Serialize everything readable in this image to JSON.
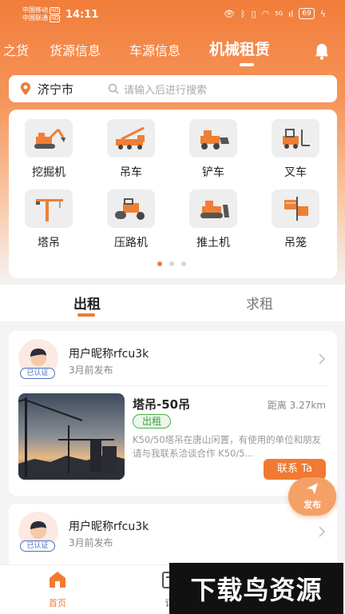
{
  "status_bar": {
    "carrier1": "中国移动",
    "carrier2": "中国联通",
    "hd": "HD",
    "time": "14:11",
    "signal_label": "5G",
    "battery": "69"
  },
  "top_tabs": [
    {
      "label": "之货"
    },
    {
      "label": "货源信息"
    },
    {
      "label": "车源信息"
    },
    {
      "label": "机械租赁",
      "active": true
    }
  ],
  "search": {
    "city": "济宁市",
    "placeholder": "请输入后进行搜索"
  },
  "categories": [
    {
      "label": "挖掘机",
      "icon": "excavator-icon"
    },
    {
      "label": "吊车",
      "icon": "crane-truck-icon"
    },
    {
      "label": "铲车",
      "icon": "loader-icon"
    },
    {
      "label": "叉车",
      "icon": "forklift-icon"
    },
    {
      "label": "塔吊",
      "icon": "tower-crane-icon"
    },
    {
      "label": "压路机",
      "icon": "road-roller-icon"
    },
    {
      "label": "推土机",
      "icon": "bulldozer-icon"
    },
    {
      "label": "吊笼",
      "icon": "hoist-cage-icon"
    }
  ],
  "pager": {
    "pages": 3,
    "current": 1
  },
  "sub_tabs": {
    "rent_out": "出租",
    "seek_rent": "求租"
  },
  "posts": [
    {
      "nickname": "用户昵称rfcu3k",
      "time": "3月前发布",
      "verified": "已认证",
      "title": "塔吊-50吊",
      "distance": "距离 3.27km",
      "tag": "出租",
      "desc": "K50/50塔吊在唐山闲置，有使用的单位和朋友请与我联系洽谈合作 K50/5...",
      "contact": "联系 Ta"
    },
    {
      "nickname": "用户昵称rfcu3k",
      "time": "3月前发布",
      "verified": "已认证"
    }
  ],
  "fab": {
    "label": "发布"
  },
  "bottom_nav": {
    "home": "首页",
    "second": "订"
  },
  "watermark": "下载鸟资源",
  "colors": {
    "accent": "#f07a32",
    "tag_green": "#3a9e3a",
    "verified_blue": "#4c6fc0"
  }
}
